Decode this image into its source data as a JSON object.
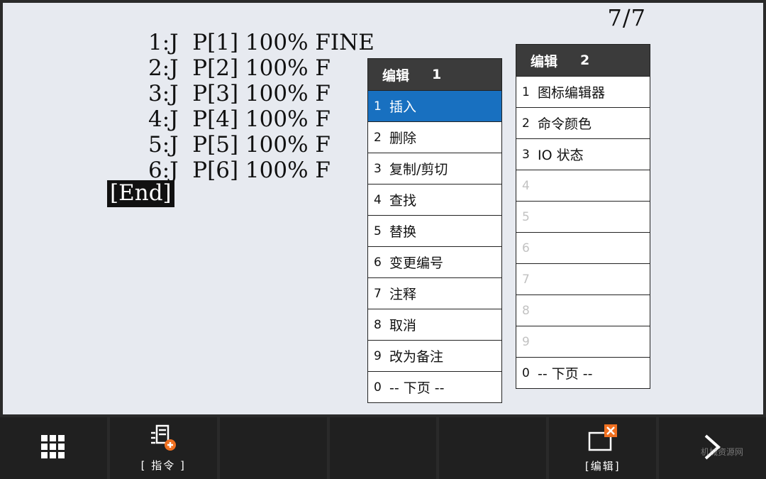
{
  "page_counter": "7/7",
  "program_lines": [
    "1:J  P[1] 100% FINE",
    "2:J  P[2] 100% F",
    "3:J  P[3] 100% F",
    "4:J  P[4] 100% F",
    "5:J  P[5] 100% F",
    "6:J  P[6] 100% F"
  ],
  "end_marker": "[End]",
  "menu1": {
    "title": "编辑",
    "page": "1",
    "items": [
      {
        "num": "1",
        "label": "插入",
        "selected": true
      },
      {
        "num": "2",
        "label": "删除"
      },
      {
        "num": "3",
        "label": "复制/剪切"
      },
      {
        "num": "4",
        "label": "查找"
      },
      {
        "num": "5",
        "label": "替换"
      },
      {
        "num": "6",
        "label": "变更编号"
      },
      {
        "num": "7",
        "label": "注释"
      },
      {
        "num": "8",
        "label": "取消"
      },
      {
        "num": "9",
        "label": "改为备注"
      },
      {
        "num": "0",
        "label": "-- 下页 --"
      }
    ]
  },
  "menu2": {
    "title": "编辑",
    "page": "2",
    "items": [
      {
        "num": "1",
        "label": "图标编辑器"
      },
      {
        "num": "2",
        "label": "命令颜色"
      },
      {
        "num": "3",
        "label": "IO 状态"
      },
      {
        "num": "4",
        "label": "",
        "disabled": true
      },
      {
        "num": "5",
        "label": "",
        "disabled": true
      },
      {
        "num": "6",
        "label": "",
        "disabled": true
      },
      {
        "num": "7",
        "label": "",
        "disabled": true
      },
      {
        "num": "8",
        "label": "",
        "disabled": true
      },
      {
        "num": "9",
        "label": "",
        "disabled": true
      },
      {
        "num": "0",
        "label": "-- 下页 --"
      }
    ]
  },
  "softkeys": {
    "instruction_label": "[ 指令 ]",
    "edit_label": "[编辑]"
  },
  "watermark": "机械资源网",
  "colors": {
    "screen_bg": "#e7eaf0",
    "menu_header": "#3b3b3b",
    "selected": "#1870c0",
    "accent_orange": "#f07020"
  }
}
